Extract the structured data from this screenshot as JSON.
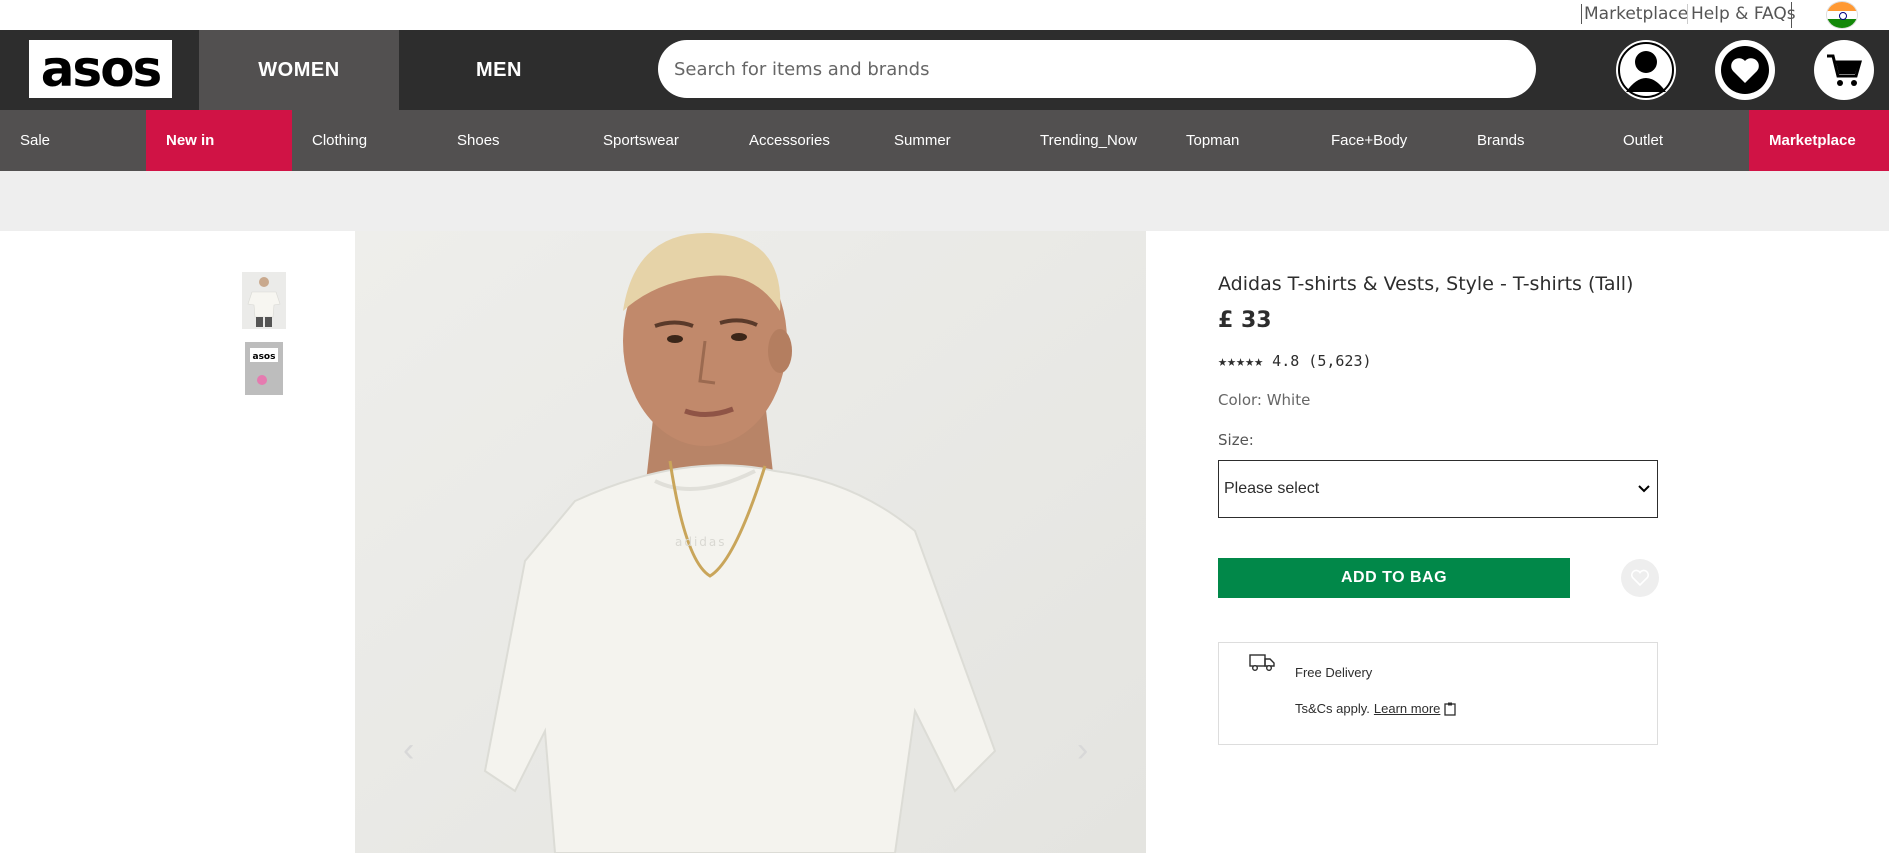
{
  "utility": {
    "marketplace": "Marketplace",
    "help": "Help & FAQs"
  },
  "header": {
    "logo": "asos",
    "tabs": [
      {
        "label": "WOMEN"
      },
      {
        "label": "MEN"
      }
    ],
    "search_placeholder": "Search for items and brands",
    "icons": [
      "account-icon",
      "heart-icon",
      "shopping-cart-icon"
    ]
  },
  "nav": {
    "items": [
      {
        "label": "Sale"
      },
      {
        "label": "New in"
      },
      {
        "label": "Clothing"
      },
      {
        "label": "Shoes"
      },
      {
        "label": "Sportswear"
      },
      {
        "label": "Accessories"
      },
      {
        "label": "Summer"
      },
      {
        "label": "Trending_Now"
      },
      {
        "label": "Topman"
      },
      {
        "label": "Face+Body"
      },
      {
        "label": "Brands"
      },
      {
        "label": "Outlet"
      },
      {
        "label": "Marketplace"
      }
    ]
  },
  "colors": {
    "header_bg": "#2d2d2d",
    "nav_bg": "#525050",
    "accent_red": "#d01345",
    "add_bag_green": "#018849"
  },
  "product": {
    "name": "Adidas T-shirts & Vests, Style - T-shirts (Tall)",
    "price": "£ 33",
    "rating": "★★★★★ 4.8 (5,623)",
    "color": "Color: White",
    "size_label": "Size:",
    "size_value": "Please select",
    "add_to_bag": "ADD TO BAG"
  },
  "delivery": {
    "title": "Free Delivery",
    "terms": "Ts&Cs apply.",
    "learn_more": "Learn more"
  }
}
